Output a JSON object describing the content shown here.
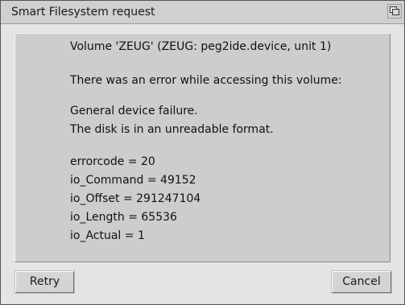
{
  "window": {
    "title": "Smart Filesystem request",
    "depth_gadget_icon": "window-depth-icon"
  },
  "message": {
    "lines": [
      "Volume 'ZEUG' (ZEUG: peg2ide.device, unit 1)",
      "There was an error while accessing this volume:",
      "General device failure.",
      "The disk is in an unreadable format.",
      "errorcode = 20",
      "io_Command = 49152",
      "io_Offset = 291247104",
      "io_Length = 65536",
      "io_Actual = 1"
    ]
  },
  "buttons": {
    "retry_label": "Retry",
    "cancel_label": "Cancel"
  },
  "colors": {
    "window_bg": "#e4e4e4",
    "titlebar_bg": "#d0d0d0",
    "message_bg": "#cdcdcd"
  }
}
